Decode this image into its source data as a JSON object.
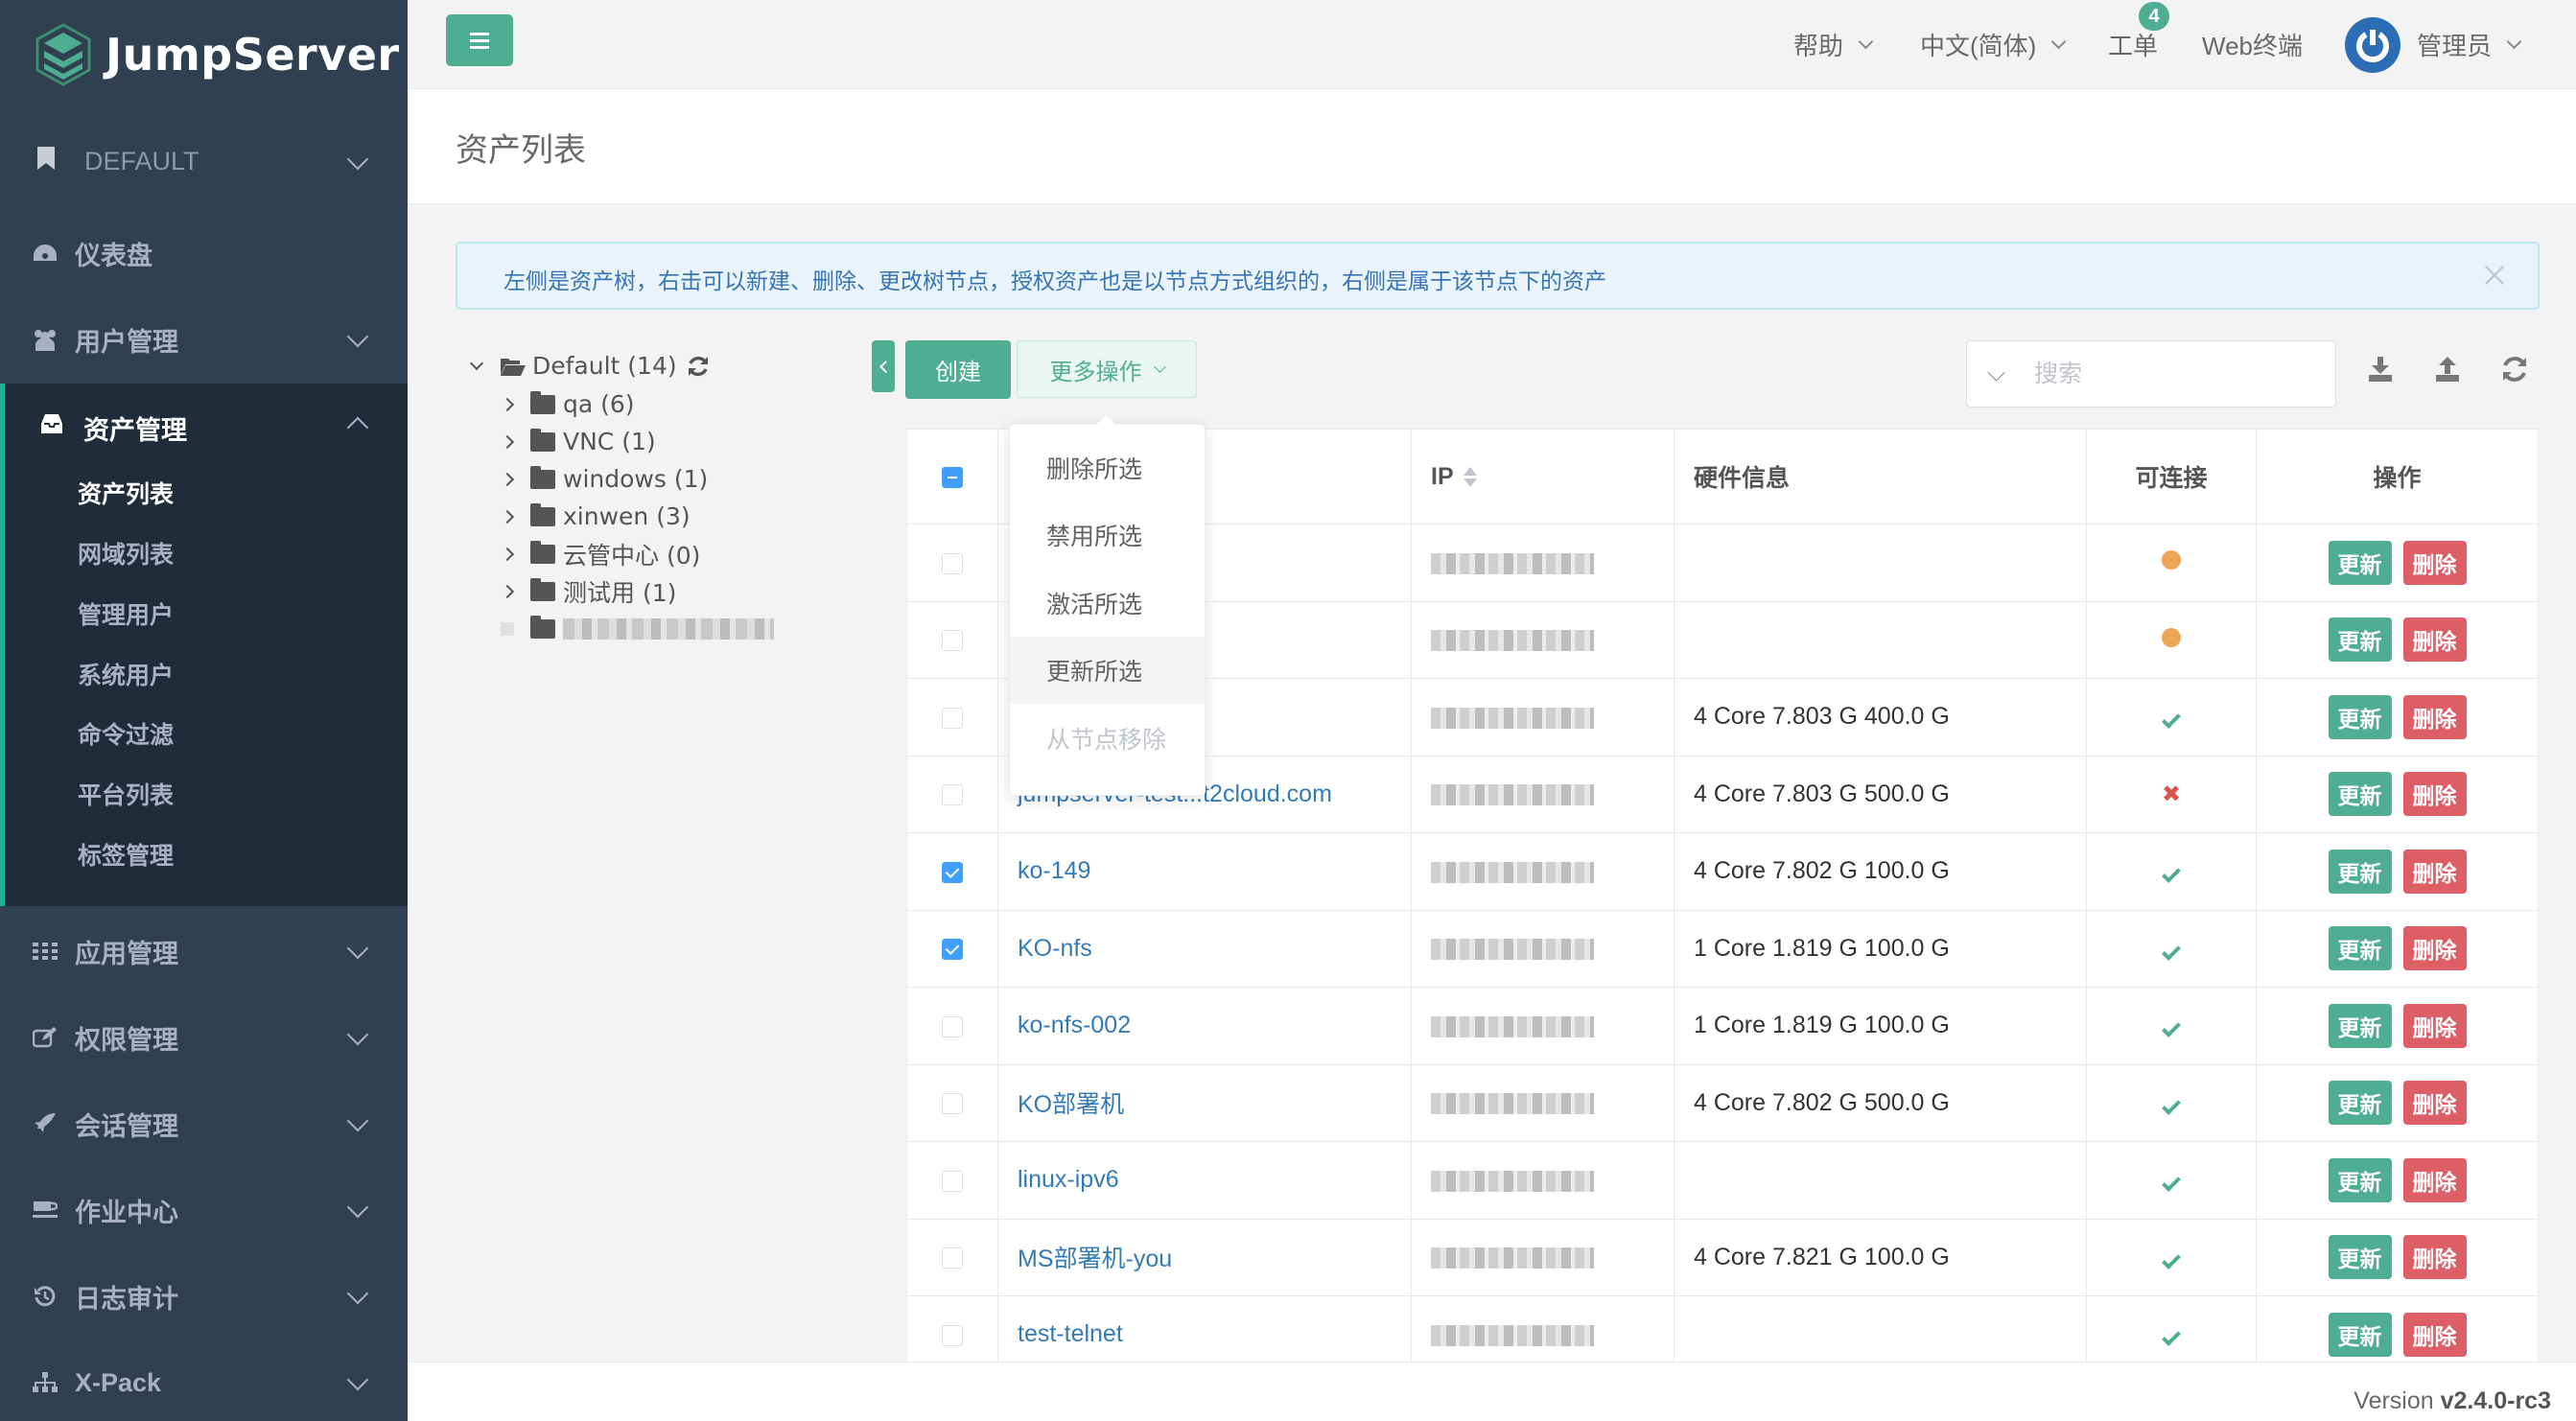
{
  "app": {
    "brand": "JumpServer",
    "brand_color": "#4fae92"
  },
  "sidebar": {
    "org": "DEFAULT",
    "items": [
      {
        "label": "仪表盘",
        "icon": "dashboard-icon"
      },
      {
        "label": "用户管理",
        "icon": "users-icon"
      },
      {
        "label": "资产管理",
        "icon": "inbox-icon"
      },
      {
        "label": "应用管理",
        "icon": "grid-icon"
      },
      {
        "label": "权限管理",
        "icon": "edit-icon"
      },
      {
        "label": "会话管理",
        "icon": "rocket-icon"
      },
      {
        "label": "作业中心",
        "icon": "coffee-icon"
      },
      {
        "label": "日志审计",
        "icon": "history-icon"
      },
      {
        "label": "X-Pack",
        "icon": "sitemap-icon"
      }
    ],
    "asset_submenu": [
      {
        "label": "资产列表",
        "active": true
      },
      {
        "label": "网域列表"
      },
      {
        "label": "管理用户"
      },
      {
        "label": "系统用户"
      },
      {
        "label": "命令过滤"
      },
      {
        "label": "平台列表"
      },
      {
        "label": "标签管理"
      }
    ]
  },
  "topbar": {
    "help": "帮助",
    "language": "中文(简体)",
    "tickets": "工单",
    "tickets_badge": "4",
    "web_terminal": "Web终端",
    "user": "管理员"
  },
  "page": {
    "title": "资产列表",
    "alert": "左侧是资产树，右击可以新建、删除、更改树节点，授权资产也是以节点方式组织的，右侧是属于该节点下的资产"
  },
  "tree": {
    "root": "Default (14)",
    "nodes": [
      "qa (6)",
      "VNC (1)",
      "windows (1)",
      "xinwen (3)",
      "云管中心 (0)",
      "测试用 (1)"
    ]
  },
  "toolbar": {
    "create": "创建",
    "more_actions": "更多操作",
    "search_placeholder": "搜索"
  },
  "dropdown": {
    "items": [
      {
        "label": "删除所选",
        "state": "normal"
      },
      {
        "label": "禁用所选",
        "state": "normal"
      },
      {
        "label": "激活所选",
        "state": "normal"
      },
      {
        "label": "更新所选",
        "state": "hover"
      },
      {
        "label": "从节点移除",
        "state": "disabled"
      }
    ]
  },
  "table": {
    "headers": {
      "ip": "IP",
      "hardware": "硬件信息",
      "connectable": "可连接",
      "actions": "操作"
    },
    "update_label": "更新",
    "delete_label": "删除",
    "rows": [
      {
        "name": "",
        "hardware": "",
        "connectable": "unknown",
        "checked": false
      },
      {
        "name": "",
        "hardware": "",
        "connectable": "unknown",
        "checked": false
      },
      {
        "name": "",
        "hardware": "4 Core 7.803 G 400.0 G",
        "connectable": "yes",
        "checked": false
      },
      {
        "name": "jumpserver-test...t2cloud.com",
        "hardware": "4 Core 7.803 G 500.0 G",
        "connectable": "no",
        "checked": false
      },
      {
        "name": "ko-149",
        "hardware": "4 Core 7.802 G 100.0 G",
        "connectable": "yes",
        "checked": true
      },
      {
        "name": "KO-nfs",
        "hardware": "1 Core 1.819 G 100.0 G",
        "connectable": "yes",
        "checked": true
      },
      {
        "name": "ko-nfs-002",
        "hardware": "1 Core 1.819 G 100.0 G",
        "connectable": "yes",
        "checked": false
      },
      {
        "name": "KO部署机",
        "hardware": "4 Core 7.802 G 500.0 G",
        "connectable": "yes",
        "checked": false
      },
      {
        "name": "linux-ipv6",
        "hardware": "",
        "connectable": "yes",
        "checked": false
      },
      {
        "name": "MS部署机-you",
        "hardware": "4 Core 7.821 G 100.0 G",
        "connectable": "yes",
        "checked": false
      },
      {
        "name": "test-telnet",
        "hardware": "",
        "connectable": "yes",
        "checked": false
      }
    ]
  },
  "footer": {
    "version_label": "Version",
    "version": "v2.4.0-rc3"
  }
}
